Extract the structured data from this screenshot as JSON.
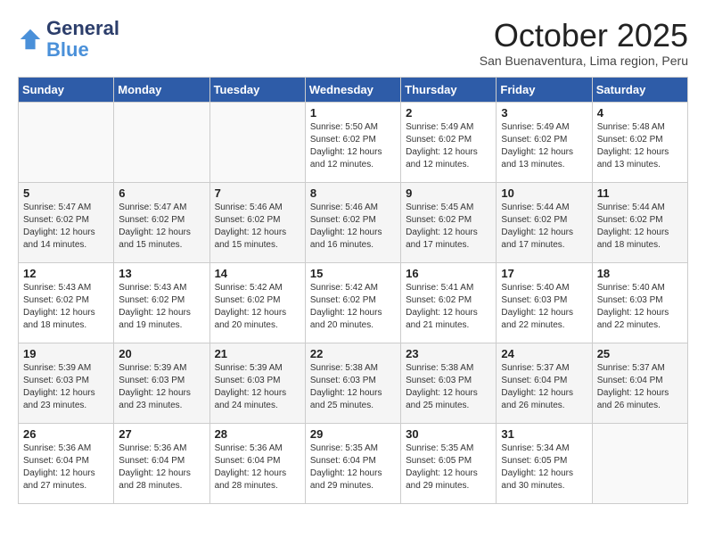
{
  "header": {
    "logo_line1": "General",
    "logo_line2": "Blue",
    "month": "October 2025",
    "location": "San Buenaventura, Lima region, Peru"
  },
  "weekdays": [
    "Sunday",
    "Monday",
    "Tuesday",
    "Wednesday",
    "Thursday",
    "Friday",
    "Saturday"
  ],
  "weeks": [
    [
      {
        "day": "",
        "info": ""
      },
      {
        "day": "",
        "info": ""
      },
      {
        "day": "",
        "info": ""
      },
      {
        "day": "1",
        "info": "Sunrise: 5:50 AM\nSunset: 6:02 PM\nDaylight: 12 hours\nand 12 minutes."
      },
      {
        "day": "2",
        "info": "Sunrise: 5:49 AM\nSunset: 6:02 PM\nDaylight: 12 hours\nand 12 minutes."
      },
      {
        "day": "3",
        "info": "Sunrise: 5:49 AM\nSunset: 6:02 PM\nDaylight: 12 hours\nand 13 minutes."
      },
      {
        "day": "4",
        "info": "Sunrise: 5:48 AM\nSunset: 6:02 PM\nDaylight: 12 hours\nand 13 minutes."
      }
    ],
    [
      {
        "day": "5",
        "info": "Sunrise: 5:47 AM\nSunset: 6:02 PM\nDaylight: 12 hours\nand 14 minutes."
      },
      {
        "day": "6",
        "info": "Sunrise: 5:47 AM\nSunset: 6:02 PM\nDaylight: 12 hours\nand 15 minutes."
      },
      {
        "day": "7",
        "info": "Sunrise: 5:46 AM\nSunset: 6:02 PM\nDaylight: 12 hours\nand 15 minutes."
      },
      {
        "day": "8",
        "info": "Sunrise: 5:46 AM\nSunset: 6:02 PM\nDaylight: 12 hours\nand 16 minutes."
      },
      {
        "day": "9",
        "info": "Sunrise: 5:45 AM\nSunset: 6:02 PM\nDaylight: 12 hours\nand 17 minutes."
      },
      {
        "day": "10",
        "info": "Sunrise: 5:44 AM\nSunset: 6:02 PM\nDaylight: 12 hours\nand 17 minutes."
      },
      {
        "day": "11",
        "info": "Sunrise: 5:44 AM\nSunset: 6:02 PM\nDaylight: 12 hours\nand 18 minutes."
      }
    ],
    [
      {
        "day": "12",
        "info": "Sunrise: 5:43 AM\nSunset: 6:02 PM\nDaylight: 12 hours\nand 18 minutes."
      },
      {
        "day": "13",
        "info": "Sunrise: 5:43 AM\nSunset: 6:02 PM\nDaylight: 12 hours\nand 19 minutes."
      },
      {
        "day": "14",
        "info": "Sunrise: 5:42 AM\nSunset: 6:02 PM\nDaylight: 12 hours\nand 20 minutes."
      },
      {
        "day": "15",
        "info": "Sunrise: 5:42 AM\nSunset: 6:02 PM\nDaylight: 12 hours\nand 20 minutes."
      },
      {
        "day": "16",
        "info": "Sunrise: 5:41 AM\nSunset: 6:02 PM\nDaylight: 12 hours\nand 21 minutes."
      },
      {
        "day": "17",
        "info": "Sunrise: 5:40 AM\nSunset: 6:03 PM\nDaylight: 12 hours\nand 22 minutes."
      },
      {
        "day": "18",
        "info": "Sunrise: 5:40 AM\nSunset: 6:03 PM\nDaylight: 12 hours\nand 22 minutes."
      }
    ],
    [
      {
        "day": "19",
        "info": "Sunrise: 5:39 AM\nSunset: 6:03 PM\nDaylight: 12 hours\nand 23 minutes."
      },
      {
        "day": "20",
        "info": "Sunrise: 5:39 AM\nSunset: 6:03 PM\nDaylight: 12 hours\nand 23 minutes."
      },
      {
        "day": "21",
        "info": "Sunrise: 5:39 AM\nSunset: 6:03 PM\nDaylight: 12 hours\nand 24 minutes."
      },
      {
        "day": "22",
        "info": "Sunrise: 5:38 AM\nSunset: 6:03 PM\nDaylight: 12 hours\nand 25 minutes."
      },
      {
        "day": "23",
        "info": "Sunrise: 5:38 AM\nSunset: 6:03 PM\nDaylight: 12 hours\nand 25 minutes."
      },
      {
        "day": "24",
        "info": "Sunrise: 5:37 AM\nSunset: 6:04 PM\nDaylight: 12 hours\nand 26 minutes."
      },
      {
        "day": "25",
        "info": "Sunrise: 5:37 AM\nSunset: 6:04 PM\nDaylight: 12 hours\nand 26 minutes."
      }
    ],
    [
      {
        "day": "26",
        "info": "Sunrise: 5:36 AM\nSunset: 6:04 PM\nDaylight: 12 hours\nand 27 minutes."
      },
      {
        "day": "27",
        "info": "Sunrise: 5:36 AM\nSunset: 6:04 PM\nDaylight: 12 hours\nand 28 minutes."
      },
      {
        "day": "28",
        "info": "Sunrise: 5:36 AM\nSunset: 6:04 PM\nDaylight: 12 hours\nand 28 minutes."
      },
      {
        "day": "29",
        "info": "Sunrise: 5:35 AM\nSunset: 6:04 PM\nDaylight: 12 hours\nand 29 minutes."
      },
      {
        "day": "30",
        "info": "Sunrise: 5:35 AM\nSunset: 6:05 PM\nDaylight: 12 hours\nand 29 minutes."
      },
      {
        "day": "31",
        "info": "Sunrise: 5:34 AM\nSunset: 6:05 PM\nDaylight: 12 hours\nand 30 minutes."
      },
      {
        "day": "",
        "info": ""
      }
    ]
  ]
}
